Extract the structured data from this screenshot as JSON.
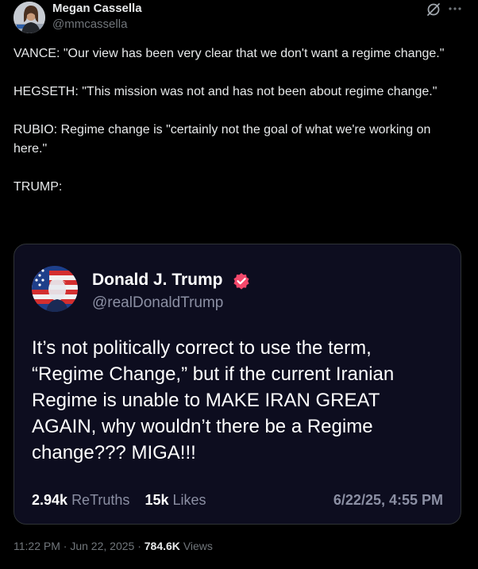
{
  "author": {
    "name": "Megan Cassella",
    "handle": "@mmcassella"
  },
  "tweet": {
    "paragraphs": [
      "VANCE: \"Our view has been very clear that we don't want a regime change.\"",
      "HEGSETH: \"This mission was not and has not been about regime change.\"",
      "RUBIO: Regime change is \"certainly not the goal of what we're working on here.\"",
      "TRUMP:"
    ]
  },
  "quote": {
    "name": "Donald J. Trump",
    "handle": "@realDonaldTrump",
    "text": "It’s not politically correct to use the term, “Regime Change,” but if the current Iranian Regime is unable to MAKE IRAN GREAT AGAIN, why wouldn’t there be a Regime change??? MIGA!!!",
    "retruths_count": "2.94k",
    "retruths_label": "ReTruths",
    "likes_count": "15k",
    "likes_label": "Likes",
    "date": "6/22/25, 4:55 PM",
    "verified_color": "#f4486b"
  },
  "meta": {
    "time": "11:22 PM",
    "sep1": "·",
    "date": "Jun 22, 2025",
    "sep2": "·",
    "views_count": "784.6K",
    "views_label": "Views"
  },
  "colors": {
    "background": "#000000",
    "card_background": "#0d0d1f",
    "muted": "#71767b"
  }
}
